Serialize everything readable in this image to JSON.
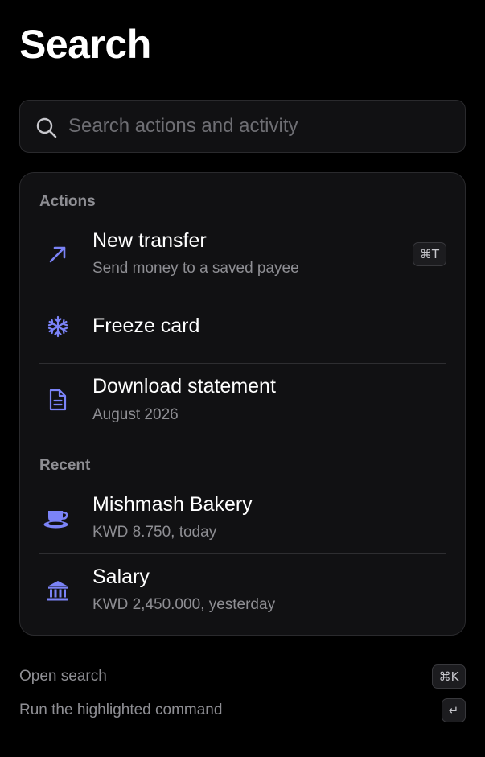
{
  "header": {
    "title": "Search"
  },
  "search": {
    "placeholder": "Search actions and activity",
    "value": ""
  },
  "actions": {
    "label": "Actions",
    "items": [
      {
        "title": "New transfer",
        "subtitle": "Send money to a saved payee",
        "shortcut": "⌘T",
        "icon": "arrow-up-right-icon"
      },
      {
        "title": "Freeze card",
        "icon": "snowflake-icon"
      },
      {
        "title": "Download statement",
        "subtitle": "August 2026",
        "icon": "document-icon"
      }
    ]
  },
  "recent": {
    "label": "Recent",
    "items": [
      {
        "title": "Mishmash Bakery",
        "subtitle": "KWD 8.750, today",
        "icon": "coffee-cup-icon"
      },
      {
        "title": "Salary",
        "subtitle": "KWD 2,450.000, yesterday",
        "icon": "bank-icon"
      }
    ]
  },
  "footer": {
    "hints": [
      {
        "label": "Open search",
        "key": "⌘K"
      },
      {
        "label": "Run the highlighted command",
        "key": "↵"
      }
    ]
  },
  "colors": {
    "accent": "#7b83f7",
    "background": "#000000",
    "panel": "#111113",
    "muted": "#8e8e93"
  }
}
